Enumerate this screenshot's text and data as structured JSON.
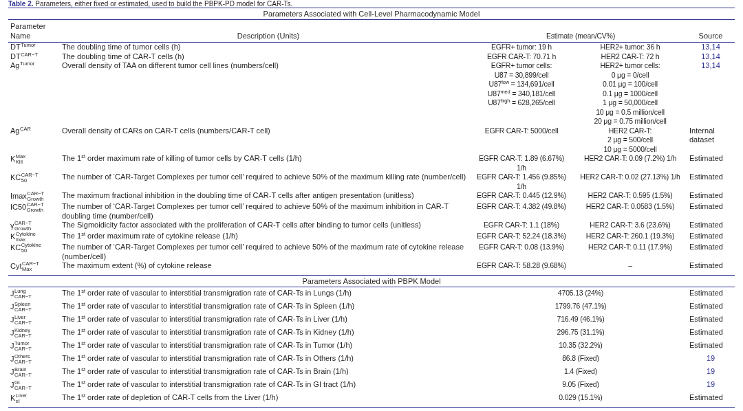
{
  "caption": "**Table 2.** Parameters, either fixed or estimated, used to build the PBPK-PD model for CAR-Ts.",
  "sections": [
    {
      "title": "Parameters Associated with Cell-Level Pharmacodynamic Model",
      "columns": [
        "Parameter Name",
        "Description (Units)",
        "Estimate (mean/CV%)",
        "Source"
      ],
      "rows": [
        {
          "symbol": {
            "base": "DT",
            "sup": "Tumor"
          },
          "description": "The doubling time of tumor cells (h)",
          "estimates": [
            [
              "EGFR+ tumor: 19 h"
            ],
            [
              "HER2+ tumor: 36 h"
            ]
          ],
          "source": {
            "kind": "citation",
            "text": "13,14"
          }
        },
        {
          "symbol": {
            "base": "DT",
            "sup": "CAR−T"
          },
          "description": "The doubling time of CAR-T cells (h)",
          "estimates": [
            [
              "EGFR CAR-T: 70.71 h"
            ],
            [
              "HER2 CAR-T: 72 h"
            ]
          ],
          "source": {
            "kind": "citation",
            "text": "13,14"
          }
        },
        {
          "symbol": {
            "base": "Ag",
            "sup": "Tumor"
          },
          "description": "Overall density of TAA on different tumor cell lines (numbers/cell)",
          "estimates": [
            [
              "EGFR+ tumor cells:",
              "U87 = 30,899/cell",
              "U87$^{low}$ = 134,691/cell",
              "U87$^{med}$ = 340,181/cell",
              "U87$^{high}$ = 628,265/cell"
            ],
            [
              "HER2+ tumor cells:",
              "0 μg = 0/cell",
              "0.01 μg = 100/cell",
              "0.1 μg = 1000/cell",
              "1 μg = 50,000/cell",
              "10 μg = 0.5 million/cell",
              "20 μg = 0.75 million/cell"
            ]
          ],
          "source": {
            "kind": "citation",
            "text": "13,14"
          }
        },
        {
          "symbol": {
            "base": "Ag",
            "sup": "CAR"
          },
          "description": "Overall density of CARs on CAR-T cells (numbers/CAR-T cell)",
          "estimates": [
            [
              "EGFR CAR-T: 5000/cell"
            ],
            [
              "HER2 CAR-T:",
              "2 μg = 500/cell",
              "10 μg = 5000/cell"
            ]
          ],
          "source": {
            "kind": "text",
            "text": "Internal dataset"
          }
        },
        {
          "symbol": {
            "base": "K",
            "sup": "Max",
            "sub": "Kill"
          },
          "description": "The 1$^{st}$ order maximum rate of killing of tumor cells by CAR-T cells (1/h)",
          "estimates": [
            [
              "EGFR CAR-T: 1.89 (6.67%) 1/h"
            ],
            [
              "HER2 CAR-T: 0.09 (7.2%) 1/h"
            ]
          ],
          "source": {
            "kind": "text",
            "text": "Estimated"
          }
        },
        {
          "symbol": {
            "base": "KC",
            "sup": "CAR−T",
            "sub": "50"
          },
          "description": "The number of ‘CAR-Target Complexes per tumor cell’ required to achieve 50% of the maximum killing rate (number/cell)",
          "estimates": [
            [
              "EGFR CAR-T: 1.456 (9.85%) 1/h"
            ],
            [
              "HER2 CAR-T: 0.02 (27.13%) 1/h"
            ]
          ],
          "source": {
            "kind": "text",
            "text": "Estimated"
          }
        },
        {
          "symbol": {
            "base": "Imax",
            "sup": "CAR−T",
            "sub": "Growth"
          },
          "description": "The maximum fractional inhibition in the doubling time of CAR-T cells after antigen presentation (unitless)",
          "estimates": [
            [
              "EGFR CAR-T: 0.445 (12.9%)"
            ],
            [
              "HER2 CAR-T: 0.595 (1.5%)"
            ]
          ],
          "source": {
            "kind": "text",
            "text": "Estimated"
          }
        },
        {
          "symbol": {
            "base": "IC50",
            "sup": "CAR−T",
            "sub": "Growth"
          },
          "description": "The number of ‘CAR-Target Complexes per tumor cell’ required to achieve 50% of the maximum inhibition in CAR-T doubling time (number/cell)",
          "estimates": [
            [
              "EGFR CAR-T: 4.382 (49.8%)"
            ],
            [
              "HER2 CAR-T: 0.0583 (1.5%)"
            ]
          ],
          "source": {
            "kind": "text",
            "text": "Estimated"
          }
        },
        {
          "symbol": {
            "base": "γ",
            "sup": "CAR−T",
            "sub": "Growth"
          },
          "description": "The Sigmoidicity factor associated with the proliferation of CAR-T cells after binding to tumor cells (unitless)",
          "estimates": [
            [
              "EGFR CAR-T: 1.1 (18%)"
            ],
            [
              "HER2 CAR-T: 3.6 (23.6%)"
            ]
          ],
          "source": {
            "kind": "text",
            "text": "Estimated"
          }
        },
        {
          "symbol": {
            "base": "K",
            "sup": "Cytokine",
            "sub": "max"
          },
          "description": "The 1$^{st}$ order maximum rate of cytokine release (1/h)",
          "estimates": [
            [
              "EGFR CAR-T: 52.24 (18.3%)"
            ],
            [
              "HER2 CAR-T: 260.1 (19.3%)"
            ]
          ],
          "source": {
            "kind": "text",
            "text": "Estimated"
          }
        },
        {
          "symbol": {
            "base": "KC",
            "sup": "Cytokine",
            "sub": "50"
          },
          "description": "The number of ‘CAR-Target Complexes per tumor cell’ required to achieve 50% of the maximum rate of cytokine release (number/cell)",
          "estimates": [
            [
              "EGFR CAR-T: 0.08 (13.9%)"
            ],
            [
              "HER2 CAR-T: 0.11 (17.9%)"
            ]
          ],
          "source": {
            "kind": "text",
            "text": "Estimated"
          }
        },
        {
          "symbol": {
            "base": "Cyt",
            "sup": "CAR−T",
            "sub": "Max"
          },
          "description": "The maximum extent (%) of cytokine release",
          "estimates": [
            [
              "EGFR CAR-T: 58.28 (9.68%)"
            ],
            [
              "–"
            ]
          ],
          "source": {
            "kind": "text",
            "text": "Estimated"
          }
        }
      ]
    },
    {
      "title": "Parameters Associated with PBPK Model",
      "rows": [
        {
          "symbol": {
            "base": "J",
            "sup": "Lung",
            "sub": "CAR−T"
          },
          "description": "The 1$^{st}$ order rate of vascular to interstitial transmigration rate of CAR-Ts in Lungs (1/h)",
          "estimates": [
            [
              "4705.13 (24%)"
            ]
          ],
          "source": {
            "kind": "text",
            "text": "Estimated"
          }
        },
        {
          "symbol": {
            "base": "J",
            "sup": "Spleen",
            "sub": "CAR−T"
          },
          "description": "The 1$^{st}$ order rate of vascular to interstitial transmigration rate of CAR-Ts in Spleen (1/h)",
          "estimates": [
            [
              "1799.76 (47.1%)"
            ]
          ],
          "source": {
            "kind": "text",
            "text": "Estimated"
          }
        },
        {
          "symbol": {
            "base": "J",
            "sup": "Liver",
            "sub": "CAR−T"
          },
          "description": "The 1$^{st}$ order rate of vascular to interstitial transmigration rate of CAR-Ts in Liver (1/h)",
          "estimates": [
            [
              "716.49 (46.1%)"
            ]
          ],
          "source": {
            "kind": "text",
            "text": "Estimated"
          }
        },
        {
          "symbol": {
            "base": "J",
            "sup": "Kidney",
            "sub": "CAR−T"
          },
          "description": "The 1$^{st}$ order rate of vascular to interstitial transmigration rate of CAR-Ts in Kidney (1/h)",
          "estimates": [
            [
              "296.75 (31.1%)"
            ]
          ],
          "source": {
            "kind": "text",
            "text": "Estimated"
          }
        },
        {
          "symbol": {
            "base": "J",
            "sup": "Tumor",
            "sub": "CAR−T"
          },
          "description": "The 1$^{st}$ order rate of vascular to interstitial transmigration rate of CAR-Ts in Tumor (1/h)",
          "estimates": [
            [
              "10.35 (32.2%)"
            ]
          ],
          "source": {
            "kind": "text",
            "text": "Estimated"
          }
        },
        {
          "symbol": {
            "base": "J",
            "sup": "Others",
            "sub": "CAR−T"
          },
          "description": "The 1$^{st}$ order rate of vascular to interstitial transmigration rate of CAR-Ts in Others (1/h)",
          "estimates": [
            [
              "86.8 (Fixed)"
            ]
          ],
          "source": {
            "kind": "citation",
            "text": "19"
          }
        },
        {
          "symbol": {
            "base": "J",
            "sup": "Brain",
            "sub": "CAR−T"
          },
          "description": "The 1$^{st}$ order rate of vascular to interstitial transmigration rate of CAR-Ts in Brain (1/h)",
          "estimates": [
            [
              "1.4 (Fixed)"
            ]
          ],
          "source": {
            "kind": "citation",
            "text": "19"
          }
        },
        {
          "symbol": {
            "base": "J",
            "sup": "GI",
            "sub": "CAR−T"
          },
          "description": "The 1$^{st}$ order rate of vascular to interstitial transmigration rate of CAR-Ts in GI tract (1/h)",
          "estimates": [
            [
              "9.05 (Fixed)"
            ]
          ],
          "source": {
            "kind": "citation",
            "text": "19"
          }
        },
        {
          "symbol": {
            "base": "K",
            "sup": "Liver",
            "sub": "el"
          },
          "description": "The 1$^{st}$ order rate of depletion of CAR-T cells from the Liver (1/h)",
          "estimates": [
            [
              "0.029 (15.1%)"
            ]
          ],
          "source": {
            "kind": "text",
            "text": "Estimated"
          }
        }
      ]
    }
  ]
}
